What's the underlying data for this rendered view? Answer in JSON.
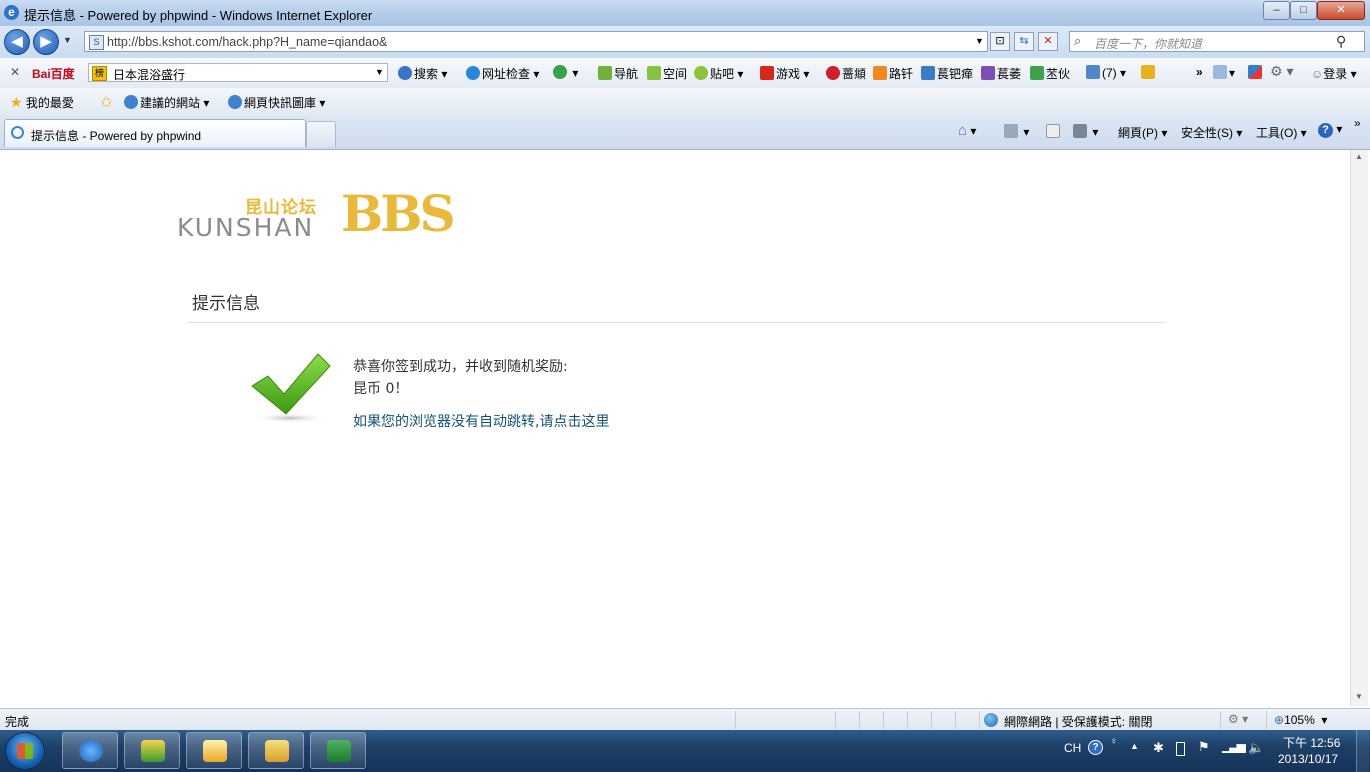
{
  "window": {
    "title": "提示信息 - Powered by phpwind - Windows Internet Explorer",
    "min": "–",
    "max": "□",
    "close": "✕"
  },
  "address": {
    "url": "http://bbs.kshot.com/hack.php?H_name=qiandao&",
    "search_placeholder": "百度一下，你就知道"
  },
  "baidu_toolbar": {
    "logo": "Bai百度",
    "combo_text": "日本混浴盛行",
    "items": [
      "搜索",
      "网址检查",
      "导航",
      "空间",
      "贴吧",
      "游戏",
      "蔷頫",
      "路钎",
      "萇钯瘅",
      "萇萎",
      "苤伙",
      "(7)",
      "登录"
    ]
  },
  "favorites": {
    "label": "我的最愛",
    "items": [
      "建議的網站",
      "網頁快訊圖庫"
    ]
  },
  "tabs": {
    "active": "提示信息 - Powered by phpwind"
  },
  "command_bar": {
    "page": "網頁(P)",
    "safety": "安全性(S)",
    "tools": "工具(O)"
  },
  "page": {
    "logo_cn": "昆山论坛",
    "logo_en": "KUNSHAN",
    "logo_bbs": "BBS",
    "heading": "提示信息",
    "message_line1": "恭喜你签到成功，并收到随机奖励:",
    "message_line2": "昆币 0！",
    "redirect_link": "如果您的浏览器没有自动跳转,请点击这里"
  },
  "status": {
    "left": "完成",
    "zone": "網際網路 | 受保護模式: 關閉",
    "zoom": "105%"
  },
  "taskbar": {
    "lang": "CH",
    "time": "下午 12:56",
    "date": "2013/10/17"
  },
  "colors": {
    "link": "#15507a",
    "logo_gold": "#e9b93a",
    "logo_gray": "#8c8c8c",
    "check_green": "#4fae1c"
  }
}
